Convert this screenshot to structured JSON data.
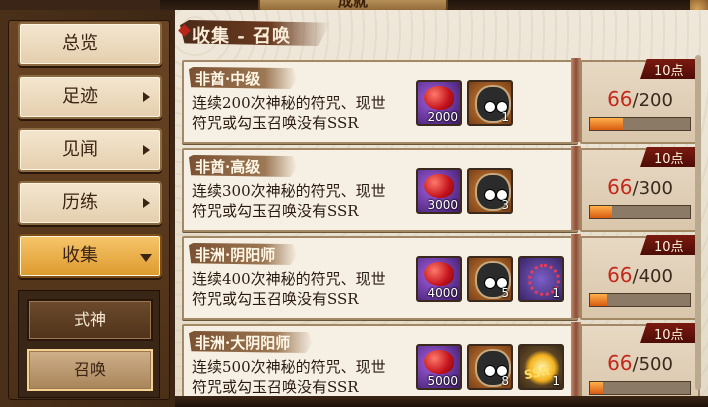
{
  "header": {
    "title": "成就"
  },
  "sidebar": {
    "items": [
      {
        "label": "总览",
        "arrow": false
      },
      {
        "label": "足迹",
        "arrow": true
      },
      {
        "label": "见闻",
        "arrow": true
      },
      {
        "label": "历练",
        "arrow": true
      },
      {
        "label": "收集",
        "arrow": true,
        "active": true
      }
    ],
    "sub_items": [
      {
        "label": "式神"
      },
      {
        "label": "召唤",
        "active": true
      }
    ]
  },
  "section": {
    "title": "收集 - 召唤"
  },
  "cards": [
    {
      "title": "非酋·中级",
      "desc_line1": "连续200次神秘的符咒、现世",
      "desc_line2": "符咒或勾玉召唤没有SSR",
      "points": "10点",
      "current": "66",
      "total": "/200",
      "progress": 0.33,
      "rewards": [
        {
          "type": "jade-icon",
          "count": "2000"
        },
        {
          "type": "daruma-icon",
          "count": "1"
        }
      ]
    },
    {
      "title": "非酋·高级",
      "desc_line1": "连续300次神秘的符咒、现世",
      "desc_line2": "符咒或勾玉召唤没有SSR",
      "points": "10点",
      "current": "66",
      "total": "/300",
      "progress": 0.22,
      "rewards": [
        {
          "type": "jade-icon",
          "count": "3000"
        },
        {
          "type": "daruma-icon",
          "count": "3"
        }
      ]
    },
    {
      "title": "非洲·阴阳师",
      "desc_line1": "连续400次神秘的符咒、现世",
      "desc_line2": "符咒或勾玉召唤没有SSR",
      "points": "10点",
      "current": "66",
      "total": "/400",
      "progress": 0.165,
      "rewards": [
        {
          "type": "jade-icon",
          "count": "4000"
        },
        {
          "type": "daruma-icon",
          "count": "5"
        },
        {
          "type": "rope-icon",
          "count": "1"
        }
      ]
    },
    {
      "title": "非洲·大阴阳师",
      "desc_line1": "连续500次神秘的符咒、现世",
      "desc_line2": "符咒或勾玉召唤没有SSR",
      "points": "10点",
      "current": "66",
      "total": "/500",
      "progress": 0.132,
      "rewards": [
        {
          "type": "jade-icon",
          "count": "5000"
        },
        {
          "type": "daruma-icon",
          "count": "8"
        },
        {
          "type": "ssr-daruma-icon",
          "count": "1",
          "badge": "SSR"
        }
      ]
    }
  ]
}
